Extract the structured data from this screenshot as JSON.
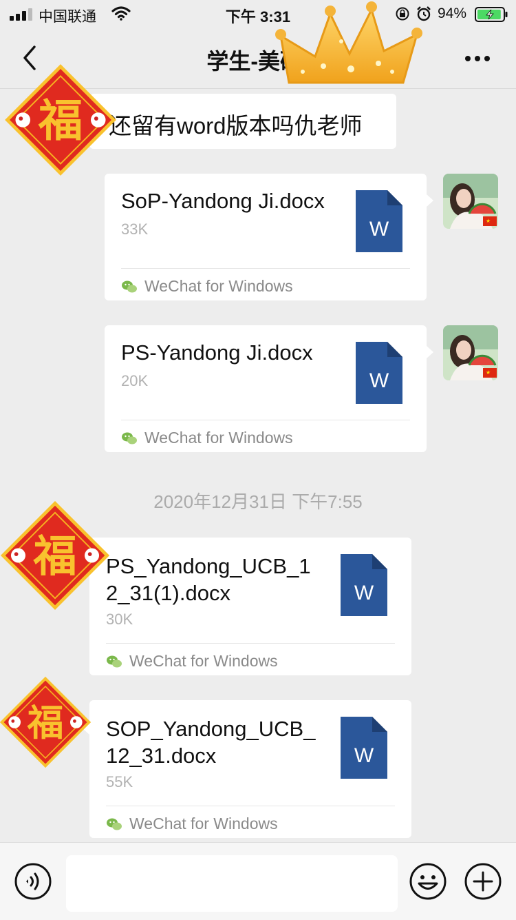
{
  "status_bar": {
    "carrier": "中国联通",
    "time": "下午 3:31",
    "battery_percent": "94%",
    "battery_level": 0.94
  },
  "nav": {
    "title": "学生-美研-",
    "back_icon": "chevron-left-icon",
    "more_icon": "more-dots-icon"
  },
  "sticker": {
    "fu_text": "福"
  },
  "messages": [
    {
      "type": "text",
      "side": "left",
      "text": "还留有word版本吗仇老师"
    },
    {
      "type": "file",
      "side": "right",
      "name": "SoP-Yandong Ji.docx",
      "size": "33K",
      "source": "WeChat for Windows"
    },
    {
      "type": "file",
      "side": "right",
      "name": "PS-Yandong Ji.docx",
      "size": "20K",
      "source": "WeChat for Windows"
    },
    {
      "type": "timestamp",
      "text": "2020年12月31日 下午7:55"
    },
    {
      "type": "file",
      "side": "left",
      "name": "PS_Yandong_UCB_12_31(1).docx",
      "size": "30K",
      "source": "WeChat for Windows"
    },
    {
      "type": "file",
      "side": "left",
      "name": "SOP_Yandong_UCB_12_31.docx",
      "size": "55K",
      "source": "WeChat for Windows"
    }
  ],
  "file_icon": {
    "letter": "W",
    "color": "#2b579a"
  },
  "input_bar": {
    "voice_icon": "voice-icon",
    "emoji_icon": "emoji-icon",
    "plus_icon": "plus-icon"
  },
  "colors": {
    "background": "#ededed",
    "bubble": "#ffffff",
    "word_blue": "#2b579a",
    "fu_red": "#e02a1f",
    "fu_gold": "#f9c22e"
  }
}
